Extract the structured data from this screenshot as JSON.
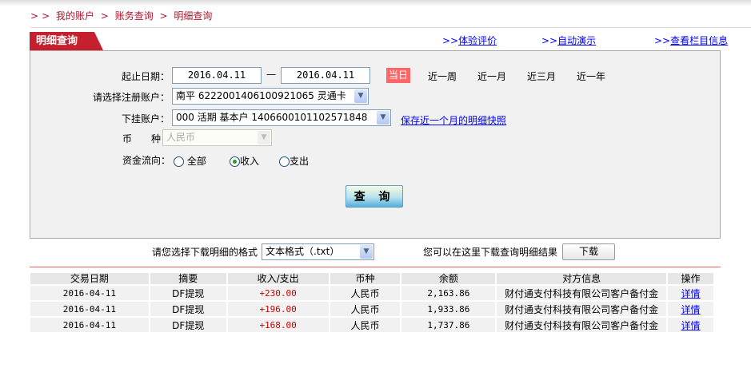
{
  "breadcrumb": [
    "我的账户",
    "账务查询",
    "明细查询"
  ],
  "tab_title": "明细查询",
  "top_links": [
    {
      "prefix": ">>",
      "label": "体验评价"
    },
    {
      "prefix": ">>",
      "label": "自动演示"
    },
    {
      "prefix": ">>",
      "label": "查看栏目信息"
    }
  ],
  "form": {
    "date_label": "起止日期：",
    "start_date": "2016.04.11",
    "dash": "—",
    "end_date": "2016.04.11",
    "quick_ranges": [
      "当日",
      "近一周",
      "近一月",
      "近三月",
      "近一年"
    ],
    "active_range": "当日",
    "account_label": "请选择注册账户：",
    "account_value": "南平 6222001406100921065 灵通卡",
    "sub_account_label": "下挂账户：",
    "sub_account_value": "000 活期 基本户 1406600101102571848",
    "snapshot_link": "保存近一个月的明细快照",
    "currency_label": "币　　种：",
    "currency_value": "人民币",
    "flow_label": "资金流向：",
    "flow_options": [
      "全部",
      "收入",
      "支出"
    ],
    "flow_selected": "收入",
    "query_button": "查 询"
  },
  "download": {
    "format_label": "请您选择下载明细的格式",
    "format_value": "文本格式（.txt）",
    "hint": "您可以在这里下载查询明细结果",
    "button": "下载"
  },
  "table": {
    "headers": [
      "交易日期",
      "摘要",
      "收入/支出",
      "币种",
      "余额",
      "对方信息",
      "操作"
    ],
    "rows": [
      [
        "2016-04-11",
        "DF提现",
        "+230.00",
        "人民币",
        "2,163.86",
        "财付通支付科技有限公司客户备付金",
        "详情"
      ],
      [
        "2016-04-11",
        "DF提现",
        "+196.00",
        "人民币",
        "1,933.86",
        "财付通支付科技有限公司客户备付金",
        "详情"
      ],
      [
        "2016-04-11",
        "DF提现",
        "+168.00",
        "人民币",
        "1,737.86",
        "财付通支付科技有限公司客户备付金",
        "详情"
      ]
    ]
  },
  "colors": {
    "brand_red": "#c4202e",
    "active_range_bg": "#ff6666",
    "amount_color": "#cc0000",
    "link": "#0000ff"
  }
}
